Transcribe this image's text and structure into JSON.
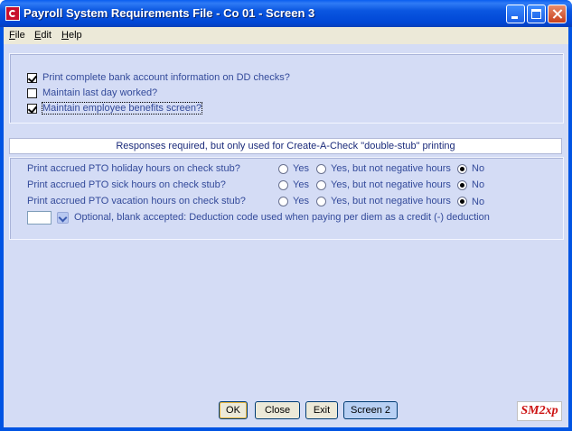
{
  "window": {
    "title": "Payroll System Requirements File - Co 01 - Screen 3"
  },
  "menu": {
    "items": [
      {
        "key": "F",
        "rest": "ile"
      },
      {
        "key": "E",
        "rest": "dit"
      },
      {
        "key": "H",
        "rest": "elp"
      }
    ]
  },
  "options": {
    "checkboxes": [
      {
        "label": "Print complete bank account information on DD checks?",
        "checked": true
      },
      {
        "label": "Maintain last day worked?",
        "checked": false
      },
      {
        "label": "Maintain employee benefits screen?",
        "checked": true
      }
    ]
  },
  "banner": {
    "text": "Responses required, but only used for Create-A-Check \"double-stub\" printing"
  },
  "pto": {
    "choices": [
      "Yes",
      "Yes, but not negative hours",
      "No"
    ],
    "questions": [
      {
        "label": "Print accrued PTO holiday hours on check stub?",
        "selected": "No"
      },
      {
        "label": "Print accrued PTO sick hours on check stub?",
        "selected": "No"
      },
      {
        "label": "Print accrued PTO vacation hours on check stub?",
        "selected": "No"
      }
    ]
  },
  "deduction": {
    "value": "",
    "label": "Optional, blank accepted: Deduction code used when paying per diem as a credit (-) deduction"
  },
  "buttons": {
    "ok": "OK",
    "close": "Close",
    "exit": "Exit",
    "screen2": "Screen 2"
  },
  "logo": {
    "text": "SM2xp"
  }
}
